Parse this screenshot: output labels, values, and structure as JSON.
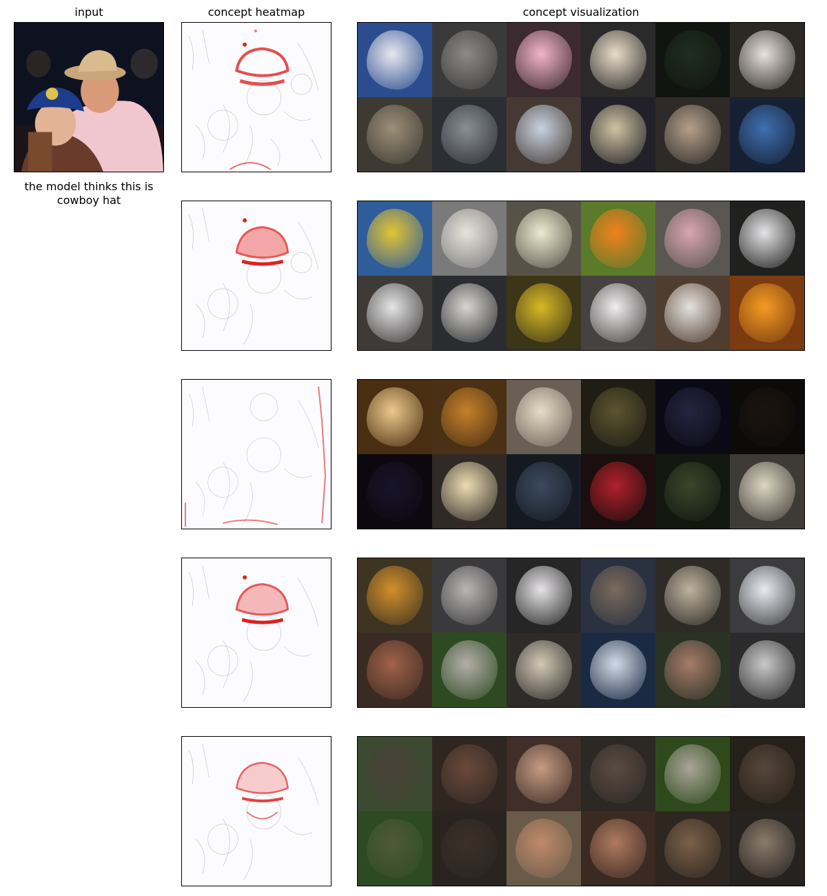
{
  "headers": {
    "input": "input",
    "heatmap": "concept heatmap",
    "visualization": "concept visualization"
  },
  "caption": "the model thinks this is cowboy hat",
  "rows": [
    {
      "tiles": [
        [
          "#2b4d8f",
          "#e8e8ee"
        ],
        [
          "#3a3a3a",
          "#8d8a86"
        ],
        [
          "#3b2a30",
          "#f3b4c8"
        ],
        [
          "#2a2a2a",
          "#e9ddc8"
        ],
        [
          "#111511",
          "#1f2d20"
        ],
        [
          "#2c2823",
          "#e8e3dc"
        ],
        [
          "#3d3a33",
          "#9b8f78"
        ],
        [
          "#2b2e33",
          "#8a8f97"
        ],
        [
          "#443a33",
          "#c8d2e0"
        ],
        [
          "#222028",
          "#cfc3a2"
        ],
        [
          "#2d2a28",
          "#b4a08a"
        ],
        [
          "#152033",
          "#3f6fb0"
        ]
      ]
    },
    {
      "tiles": [
        [
          "#2f5d9a",
          "#e2c436"
        ],
        [
          "#7a7a7a",
          "#e7e3dc"
        ],
        [
          "#565247",
          "#ecead0"
        ],
        [
          "#5b7a2a",
          "#f0821c"
        ],
        [
          "#5a5652",
          "#d9a5b0"
        ],
        [
          "#20201f",
          "#e4e4e6"
        ],
        [
          "#3d3a38",
          "#e5e5e7"
        ],
        [
          "#2b2c30",
          "#d8d6d0"
        ],
        [
          "#3c3618",
          "#d7b823"
        ],
        [
          "#46423f",
          "#efeef0"
        ],
        [
          "#4f3d30",
          "#e6e2dd"
        ],
        [
          "#7a3b10",
          "#f39b22"
        ]
      ]
    },
    {
      "tiles": [
        [
          "#4a2e12",
          "#ecc98b"
        ],
        [
          "#4a3014",
          "#c5802a"
        ],
        [
          "#6a5f55",
          "#e8dcc8"
        ],
        [
          "#1f1d14",
          "#5c5430"
        ],
        [
          "#0b0a14",
          "#262440"
        ],
        [
          "#0d0b09",
          "#1a140e"
        ],
        [
          "#0b0810",
          "#181428"
        ],
        [
          "#2f2a25",
          "#ecdcb3"
        ],
        [
          "#151a22",
          "#3c4a5e"
        ],
        [
          "#1a0e0e",
          "#b2202c"
        ],
        [
          "#121710",
          "#39462a"
        ],
        [
          "#3e3a35",
          "#ddd6c2"
        ]
      ]
    },
    {
      "tiles": [
        [
          "#3d3422",
          "#d28f2a"
        ],
        [
          "#3a3a3c",
          "#b9b6b3"
        ],
        [
          "#262626",
          "#e6e4e6"
        ],
        [
          "#2a3140",
          "#7a6a5c"
        ],
        [
          "#2e2b26",
          "#bdb29e"
        ],
        [
          "#3c3c3e",
          "#e8ecf2"
        ],
        [
          "#3a2b22",
          "#a1624a"
        ],
        [
          "#2e4a22",
          "#b3aea8"
        ],
        [
          "#2e2b28",
          "#d2c8b6"
        ],
        [
          "#1a2a42",
          "#d2dae6"
        ],
        [
          "#2a3224",
          "#a67b6a"
        ],
        [
          "#2b2b2b",
          "#c9c9c9"
        ]
      ]
    },
    {
      "tiles": [
        [
          "#3b4a30",
          "#4a4038"
        ],
        [
          "#2f2622",
          "#6a4a3a"
        ],
        [
          "#3f2f28",
          "#c59b82"
        ],
        [
          "#2c2824",
          "#5a4c42"
        ],
        [
          "#2e4a1c",
          "#a9a598"
        ],
        [
          "#25201a",
          "#57463a"
        ],
        [
          "#2e4a22",
          "#4e5a3a"
        ],
        [
          "#2a2420",
          "#3b3028"
        ],
        [
          "#6a5a4a",
          "#c08a6a"
        ],
        [
          "#3a2a22",
          "#b07a60"
        ],
        [
          "#2e2620",
          "#7a6048"
        ],
        [
          "#262220",
          "#8a7a6a"
        ]
      ]
    }
  ]
}
